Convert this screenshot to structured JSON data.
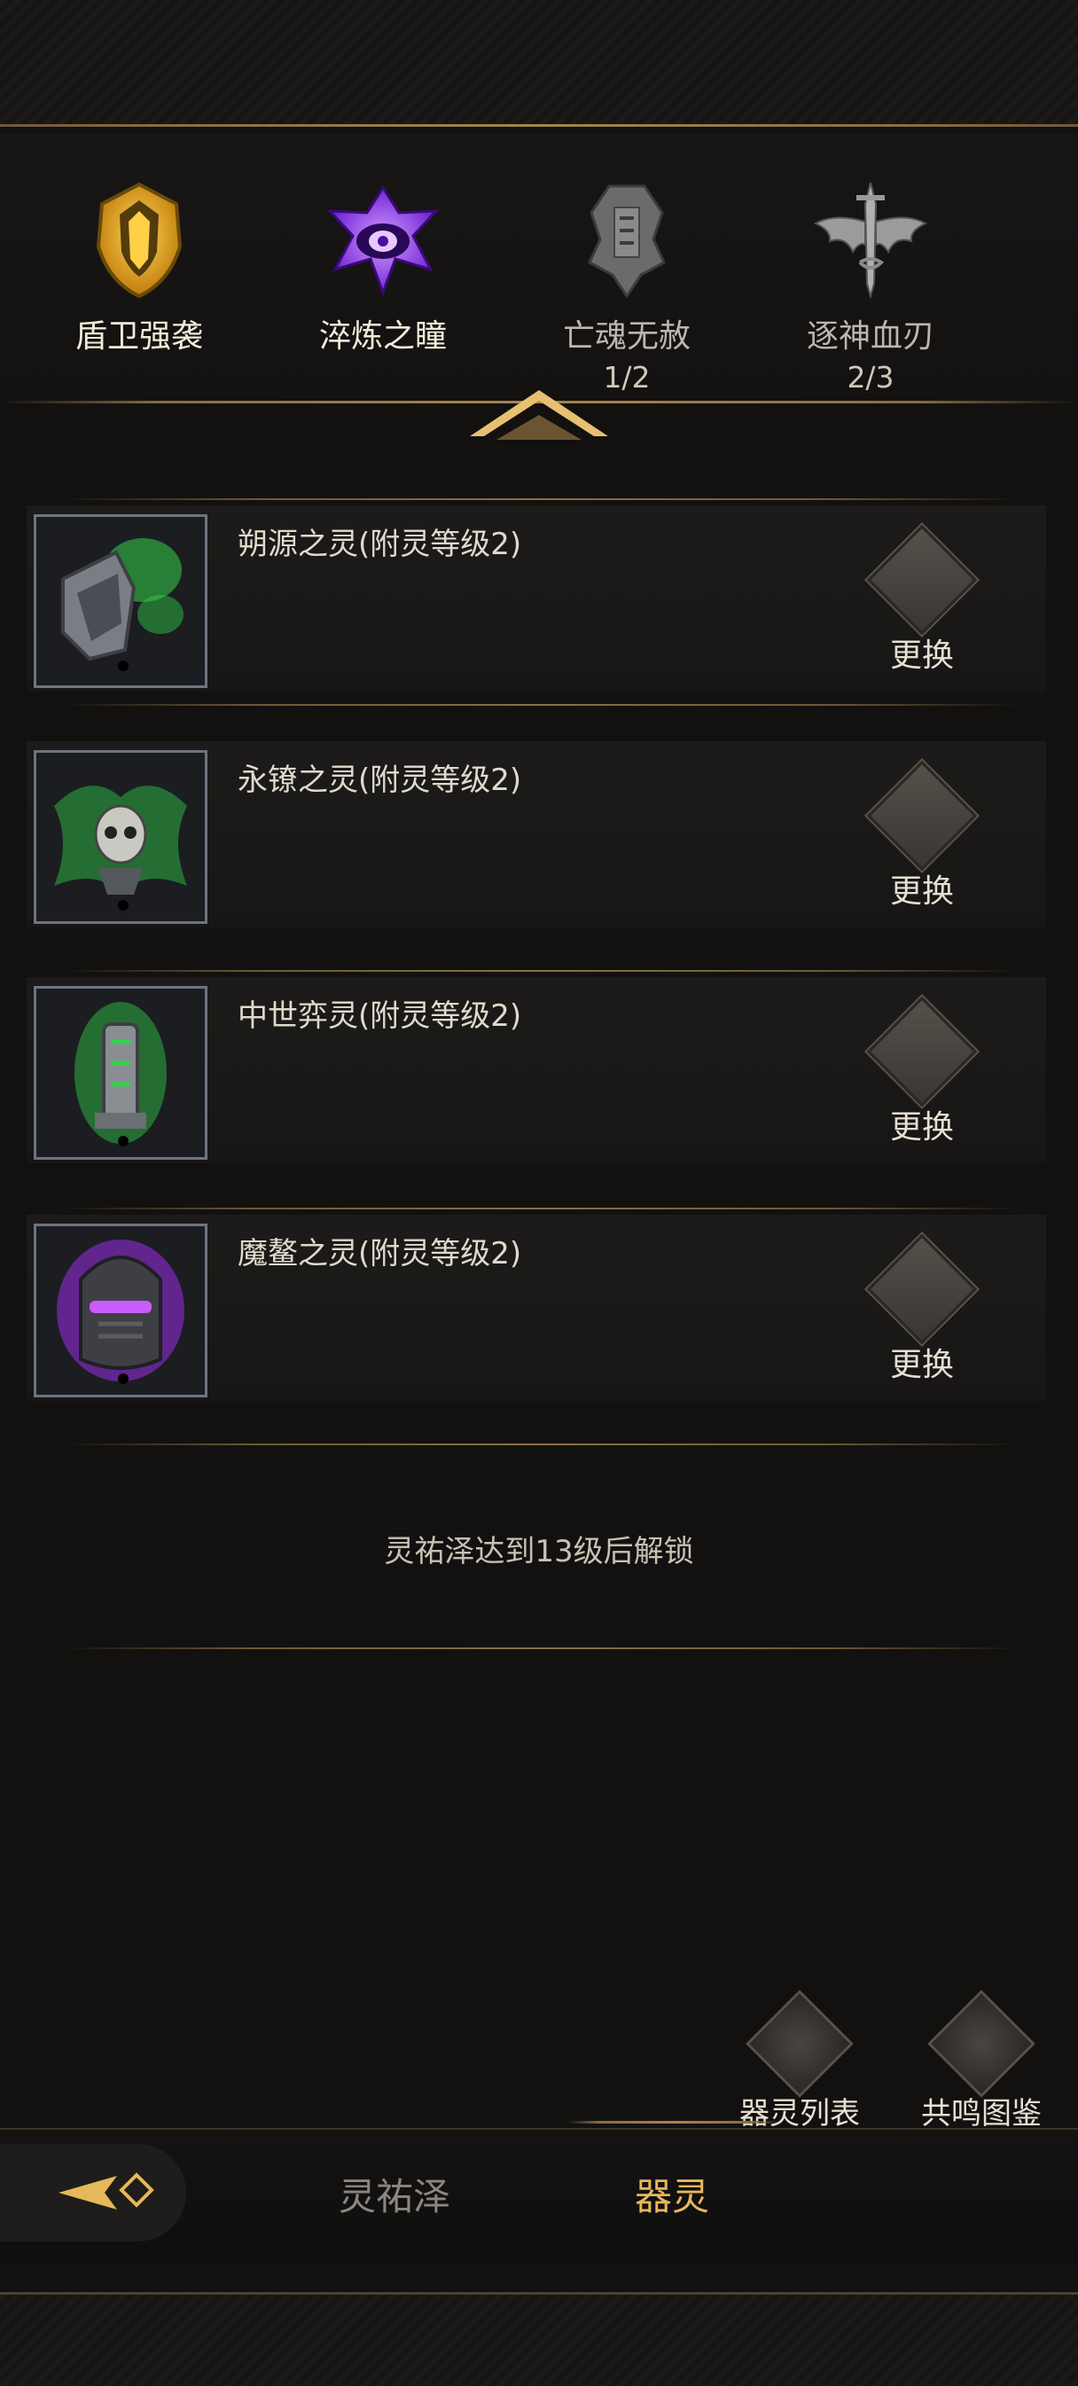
{
  "sets": [
    {
      "name": "盾卫强袭",
      "count": "",
      "color": "#e2a21c",
      "state": "active"
    },
    {
      "name": "淬炼之瞳",
      "count": "",
      "color": "#8a3ff0",
      "state": "active"
    },
    {
      "name": "亡魂无赦",
      "count": "1/2",
      "color": "#8c8c8c",
      "state": "inactive"
    },
    {
      "name": "逐神血刃",
      "count": "2/3",
      "color": "#9a9a9a",
      "state": "inactive"
    }
  ],
  "slots": [
    {
      "title": "朔源之灵(附灵等级2)",
      "button": "更换",
      "glow": "#33d24a"
    },
    {
      "title": "永镣之灵(附灵等级2)",
      "button": "更换",
      "glow": "#33d24a"
    },
    {
      "title": "中世弈灵(附灵等级2)",
      "button": "更换",
      "glow": "#33d24a"
    },
    {
      "title": "魔鳌之灵(附灵等级2)",
      "button": "更换",
      "glow": "#9b2be8"
    }
  ],
  "unlock_text": "灵祐泽达到13级后解锁",
  "actions": {
    "list_label": "器灵列表",
    "codex_label": "共鸣图鉴"
  },
  "tabs": {
    "tab1": "灵祐泽",
    "tab2": "器灵",
    "active": "器灵"
  },
  "colors": {
    "accent_gold": "#e8b85a",
    "inactive_tab": "#8d867c"
  }
}
